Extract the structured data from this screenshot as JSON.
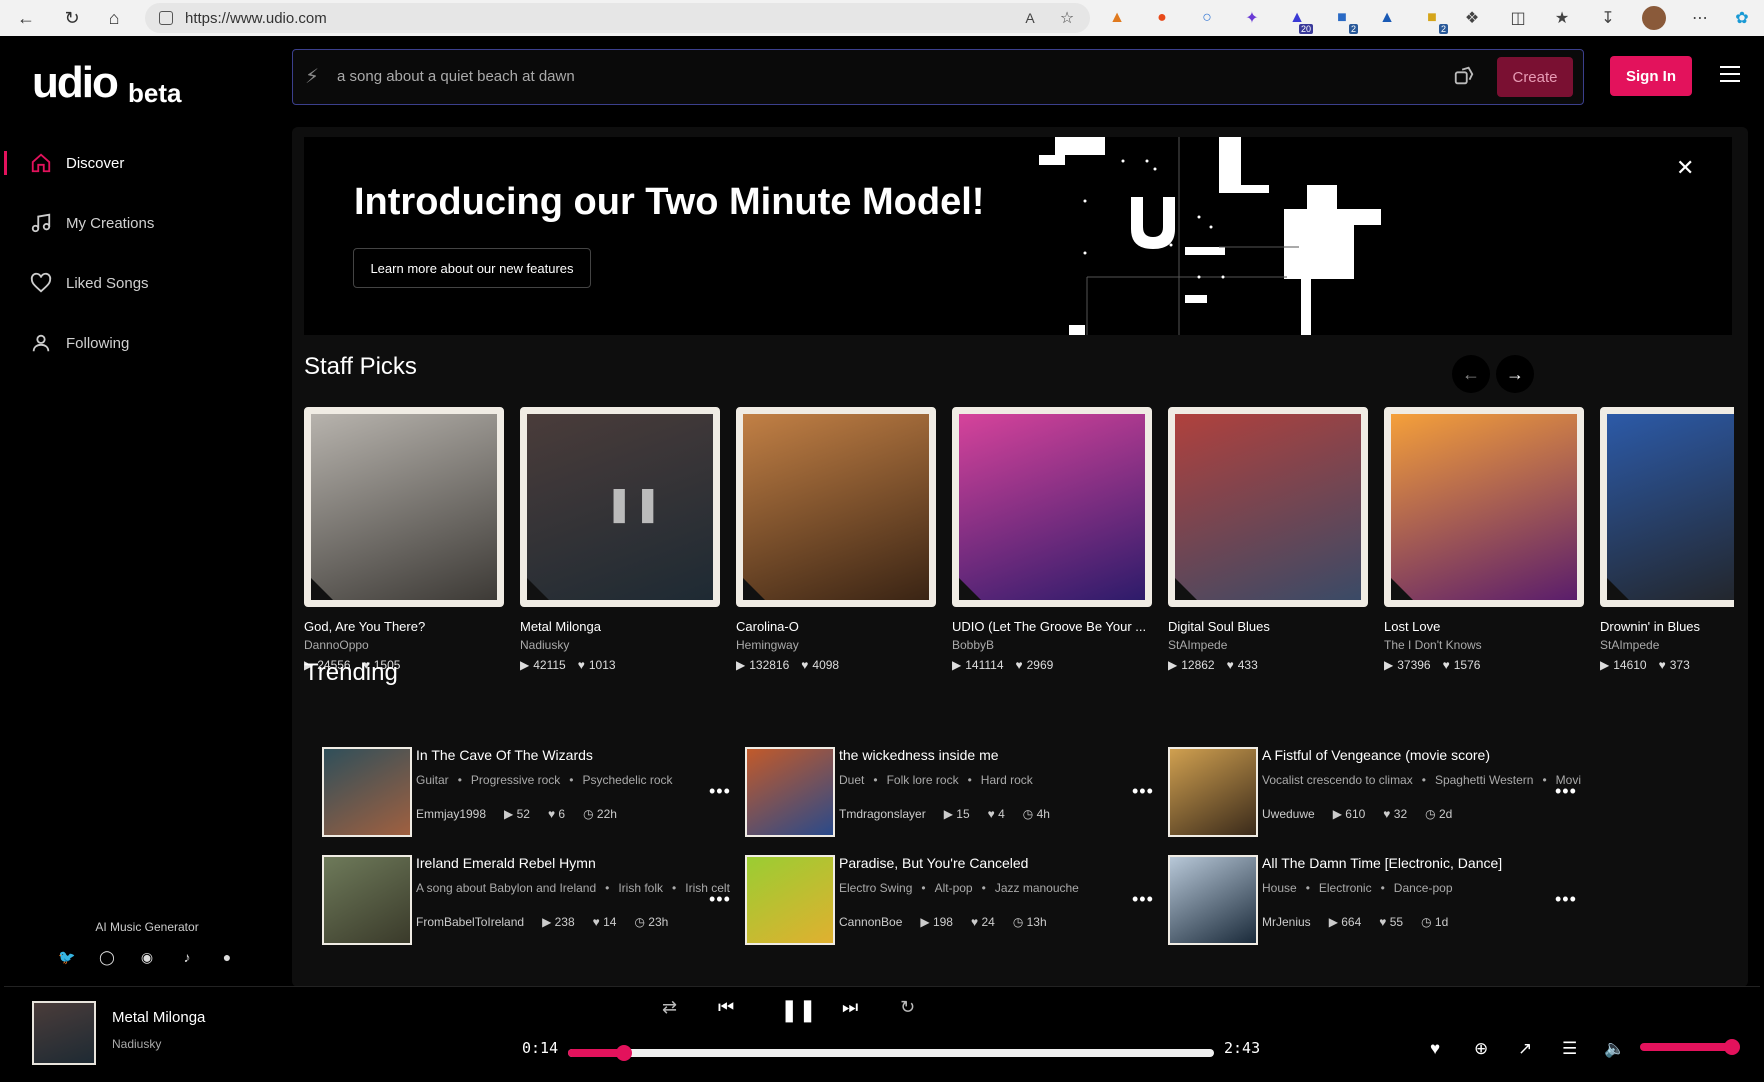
{
  "browser": {
    "url": "https://www.udio.com",
    "badges": [
      "20",
      "2",
      "2"
    ]
  },
  "app": {
    "logo": "udio",
    "logo_suffix": "beta",
    "accent": "#e3125c"
  },
  "sidebar": {
    "items": [
      {
        "label": "Discover",
        "icon": "home-icon"
      },
      {
        "label": "My Creations",
        "icon": "music-note-icon"
      },
      {
        "label": "Liked Songs",
        "icon": "heart-icon"
      },
      {
        "label": "Following",
        "icon": "user-icon"
      }
    ],
    "footer": "AI Music Generator",
    "socials": [
      "twitter-icon",
      "instagram-icon",
      "discord-icon",
      "tiktok-icon",
      "reddit-icon"
    ]
  },
  "topbar": {
    "prompt": "a song about a quiet beach at dawn",
    "create_label": "Create",
    "signin_label": "Sign In"
  },
  "banner": {
    "title": "Introducing our Two Minute Model!",
    "button": "Learn more about our new features"
  },
  "staff_picks": {
    "title": "Staff Picks",
    "items": [
      {
        "title": "God, Are You There?",
        "artist": "DannoOppo",
        "plays": "24556",
        "likes": "1505",
        "colors": [
          "#b7b3ad",
          "#3d3a36"
        ]
      },
      {
        "title": "Metal Milonga",
        "artist": "Nadiusky",
        "plays": "42115",
        "likes": "1013",
        "colors": [
          "#4a3c3a",
          "#1e2a33"
        ]
      },
      {
        "title": "Carolina-O",
        "artist": "Hemingway",
        "plays": "132816",
        "likes": "4098",
        "colors": [
          "#c28045",
          "#3a2414"
        ]
      },
      {
        "title": "UDIO (Let The Groove Be Your ...",
        "artist": "BobbyB",
        "plays": "141114",
        "likes": "2969",
        "colors": [
          "#d6439b",
          "#2d1b6a"
        ]
      },
      {
        "title": "Digital Soul Blues",
        "artist": "StAImpede",
        "plays": "12862",
        "likes": "433",
        "colors": [
          "#b0413d",
          "#3a4a66"
        ]
      },
      {
        "title": "Lost Love",
        "artist": "The I Don't Knows",
        "plays": "37396",
        "likes": "1576",
        "colors": [
          "#f5a03a",
          "#5a1d6b"
        ]
      },
      {
        "title": "Drownin' in Blues",
        "artist": "StAImpede",
        "plays": "14610",
        "likes": "373",
        "colors": [
          "#2c5aa8",
          "#222"
        ]
      }
    ]
  },
  "trending": {
    "title": "Trending",
    "items": [
      {
        "title": "In The Cave Of The Wizards",
        "tags": [
          "Guitar",
          "Progressive rock",
          "Psychedelic rock"
        ],
        "artist": "Emmjay1998",
        "plays": "52",
        "likes": "6",
        "age": "22h",
        "colors": [
          "#2f4f5a",
          "#a06040"
        ]
      },
      {
        "title": "the wickedness inside me",
        "tags": [
          "Duet",
          "Folk lore rock",
          "Hard rock"
        ],
        "artist": "Tmdragonslayer",
        "plays": "15",
        "likes": "4",
        "age": "4h",
        "colors": [
          "#c25a2a",
          "#2a4a8a"
        ]
      },
      {
        "title": "A Fistful of Vengeance (movie score)",
        "tags": [
          "Vocalist crescendo to climax",
          "Spaghetti Western",
          "Movi"
        ],
        "artist": "Uweduwe",
        "plays": "610",
        "likes": "32",
        "age": "2d",
        "colors": [
          "#d0a050",
          "#3a2a1a"
        ]
      },
      {
        "title": "Ireland Emerald Rebel Hymn",
        "tags": [
          "A song about Babylon and Ireland",
          "Irish folk",
          "Irish celt"
        ],
        "artist": "FromBabelToIreland",
        "plays": "238",
        "likes": "14",
        "age": "23h",
        "colors": [
          "#6e7a5a",
          "#3a3a2a"
        ]
      },
      {
        "title": "Paradise, But You're Canceled",
        "tags": [
          "Electro Swing",
          "Alt-pop",
          "Jazz manouche"
        ],
        "artist": "CannonBoe",
        "plays": "198",
        "likes": "24",
        "age": "13h",
        "colors": [
          "#9acd32",
          "#e0b030"
        ]
      },
      {
        "title": "All The Damn Time [Electronic, Dance]",
        "tags": [
          "House",
          "Electronic",
          "Dance-pop"
        ],
        "artist": "MrJenius",
        "plays": "664",
        "likes": "55",
        "age": "1d",
        "colors": [
          "#b8c8d8",
          "#1a2a3a"
        ]
      }
    ]
  },
  "player": {
    "title": "Metal Milonga",
    "artist": "Nadiusky",
    "elapsed": "0:14",
    "duration": "2:43",
    "progress": 0.086,
    "volume": 1.0
  }
}
